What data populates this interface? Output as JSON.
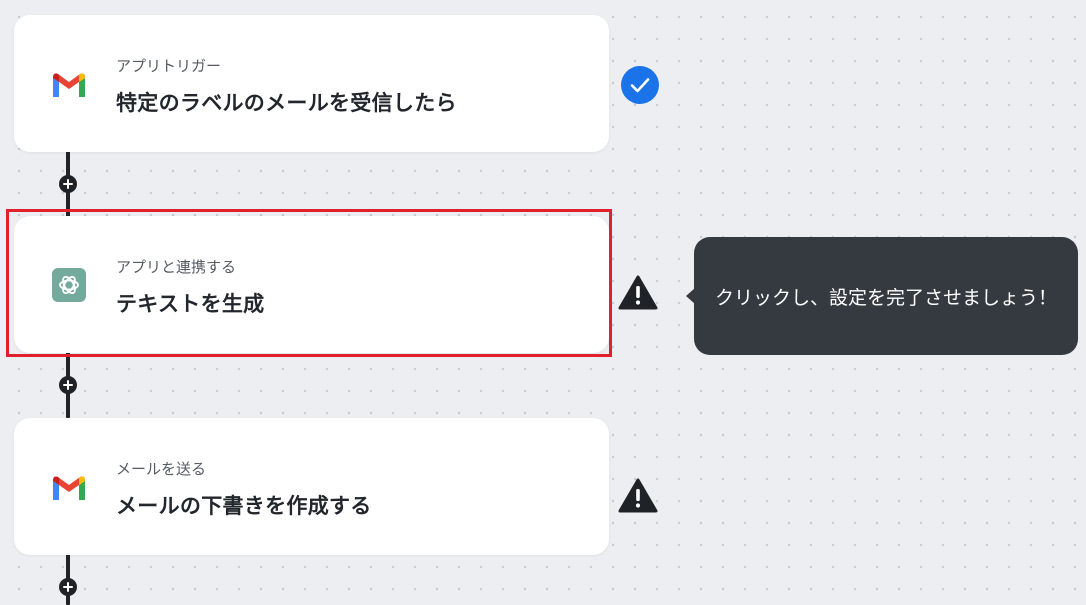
{
  "steps": [
    {
      "subtitle": "アプリトリガー",
      "title": "特定のラベルのメールを受信したら",
      "icon": "gmail-icon",
      "status": "check"
    },
    {
      "subtitle": "アプリと連携する",
      "title": "テキストを生成",
      "icon": "openai-icon",
      "status": "warning"
    },
    {
      "subtitle": "メールを送る",
      "title": "メールの下書きを作成する",
      "icon": "gmail-icon",
      "status": "warning"
    }
  ],
  "tooltip": {
    "text": "クリックし、設定を完了させましょう！"
  },
  "colors": {
    "check": "#1a73e8",
    "warning": "#1f2328",
    "highlight": "#e0202a",
    "tooltip_bg": "#353a40",
    "openai_bg": "#74aa9c"
  }
}
